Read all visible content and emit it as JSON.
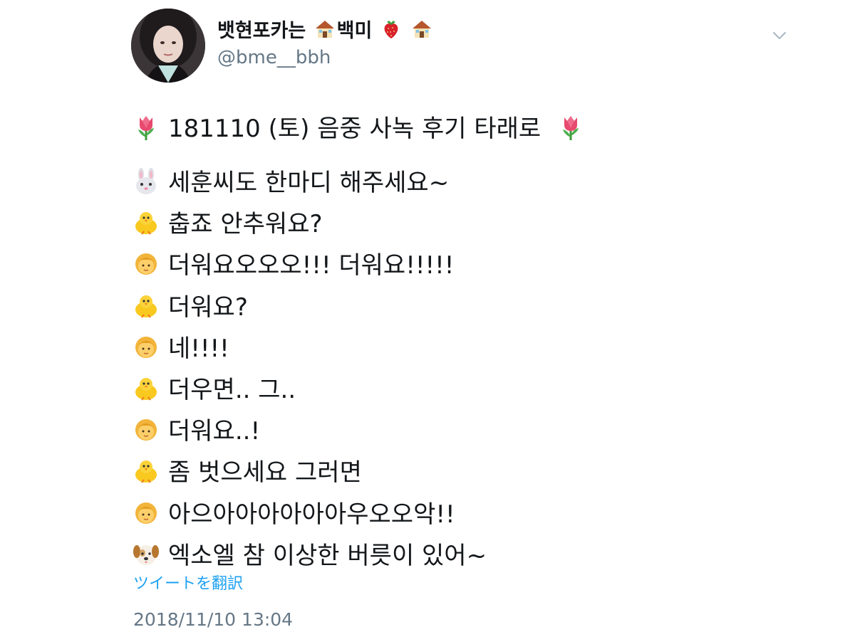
{
  "tweet": {
    "author": {
      "name_part1": "뱃현포카는",
      "name_part2": "백미",
      "handle": "@bme__bbh"
    },
    "title": "181110 (토) 음중 사녹 후기 타래로",
    "lines": [
      {
        "icon": "rabbit-icon",
        "text": "세훈씨도 한마디 해주세요~"
      },
      {
        "icon": "chick-icon",
        "text": "춥죠 안추워요?"
      },
      {
        "icon": "girl-icon",
        "text": "더워요오오오!!! 더워요!!!!!"
      },
      {
        "icon": "chick-icon",
        "text": "더워요?"
      },
      {
        "icon": "girl-icon",
        "text": "네!!!!"
      },
      {
        "icon": "chick-icon",
        "text": "더우면.. 그.."
      },
      {
        "icon": "girl-icon",
        "text": "더워요..!"
      },
      {
        "icon": "chick-icon",
        "text": "좀 벗으세요 그러면"
      },
      {
        "icon": "girl-icon",
        "text": "아으아아아아아아우오오악!!"
      },
      {
        "icon": "dog-icon",
        "text": "엑소엘 참 이상한 버릇이 있어~"
      }
    ],
    "translate_label": "ツイートを翻訳",
    "timestamp": "2018/11/10 13:04"
  },
  "icons": {
    "title_decoration": "tulip-icon",
    "name_decorations": [
      "house-icon",
      "strawberry-icon",
      "house-icon"
    ],
    "menu": "chevron-down-icon"
  },
  "colors": {
    "link": "#1da1f2",
    "secondary_text": "#657786",
    "primary_text": "#14171a"
  }
}
